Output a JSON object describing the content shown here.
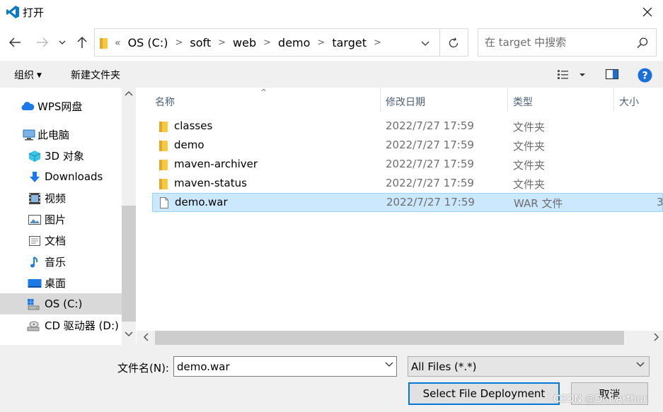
{
  "window": {
    "title": "打开"
  },
  "nav": {
    "breadcrumb_lead": "«",
    "breadcrumbs": [
      "OS (C:)",
      "soft",
      "web",
      "demo",
      "target"
    ],
    "search_placeholder": "在 target 中搜索"
  },
  "toolbar": {
    "organize_label": "组织",
    "new_folder_label": "新建文件夹"
  },
  "sidebar": {
    "items": [
      {
        "label": "WPS网盘",
        "icon": "cloud-icon"
      },
      {
        "label": "此电脑",
        "icon": "computer-icon"
      },
      {
        "label": "3D 对象",
        "icon": "cube-icon"
      },
      {
        "label": "Downloads",
        "icon": "download-icon"
      },
      {
        "label": "视频",
        "icon": "video-icon"
      },
      {
        "label": "图片",
        "icon": "picture-icon"
      },
      {
        "label": "文档",
        "icon": "document-icon"
      },
      {
        "label": "音乐",
        "icon": "music-icon"
      },
      {
        "label": "桌面",
        "icon": "desktop-icon"
      },
      {
        "label": "OS (C:)",
        "icon": "drive-icon"
      },
      {
        "label": "CD 驱动器 (D:)",
        "icon": "cd-drive-icon"
      }
    ]
  },
  "file_list": {
    "columns": [
      "名称",
      "修改日期",
      "类型",
      "大小"
    ],
    "rows": [
      {
        "name": "classes",
        "date": "2022/7/27 17:59",
        "type": "文件夹",
        "size": "",
        "icon": "folder-icon"
      },
      {
        "name": "demo",
        "date": "2022/7/27 17:59",
        "type": "文件夹",
        "size": "",
        "icon": "folder-icon"
      },
      {
        "name": "maven-archiver",
        "date": "2022/7/27 17:59",
        "type": "文件夹",
        "size": "",
        "icon": "folder-icon"
      },
      {
        "name": "maven-status",
        "date": "2022/7/27 17:59",
        "type": "文件夹",
        "size": "",
        "icon": "folder-icon"
      },
      {
        "name": "demo.war",
        "date": "2022/7/27 17:59",
        "type": "WAR 文件",
        "size": "3",
        "icon": "file-icon"
      }
    ]
  },
  "bottom": {
    "filename_label": "文件名(N):",
    "filename_value": "demo.war",
    "filter_value": "All Files (*.*)",
    "primary_button": "Select File Deployment",
    "cancel_button": "取消"
  },
  "watermark": "CSDN @Dr.F.Arthur",
  "colors": {
    "selection": "#cce8ff",
    "accent": "#0078d7",
    "folder": "#f8c93c",
    "header_text": "#4c607a"
  }
}
